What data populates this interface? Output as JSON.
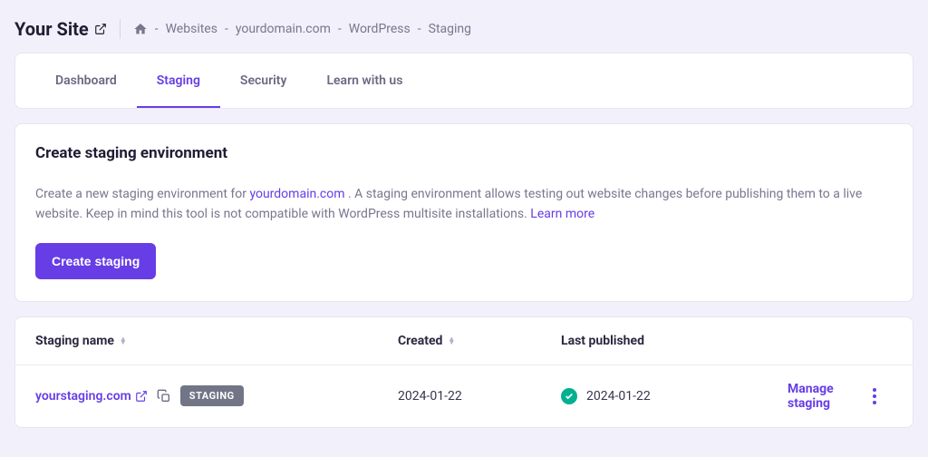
{
  "header": {
    "site_title": "Your Site",
    "breadcrumb": {
      "websites": "Websites",
      "domain": "yourdomain.com",
      "wordpress": "WordPress",
      "staging": "Staging"
    }
  },
  "tabs": {
    "dashboard": "Dashboard",
    "staging": "Staging",
    "security": "Security",
    "learn": "Learn with us"
  },
  "panel": {
    "title": "Create staging environment",
    "desc_pre": "Create a new staging environment for ",
    "domain_link": "yourdomain.com",
    "desc_post": " . A staging environment allows testing out website changes before publishing them to a live website. Keep in mind this tool is not compatible with WordPress multisite installations. ",
    "learn_more": "Learn more",
    "button": "Create staging"
  },
  "table": {
    "columns": {
      "name": "Staging name",
      "created": "Created",
      "published": "Last published"
    },
    "row": {
      "name": "yourstaging.com",
      "badge": "STAGING",
      "created": "2024-01-22",
      "published": "2024-01-22",
      "manage": "Manage staging"
    }
  }
}
